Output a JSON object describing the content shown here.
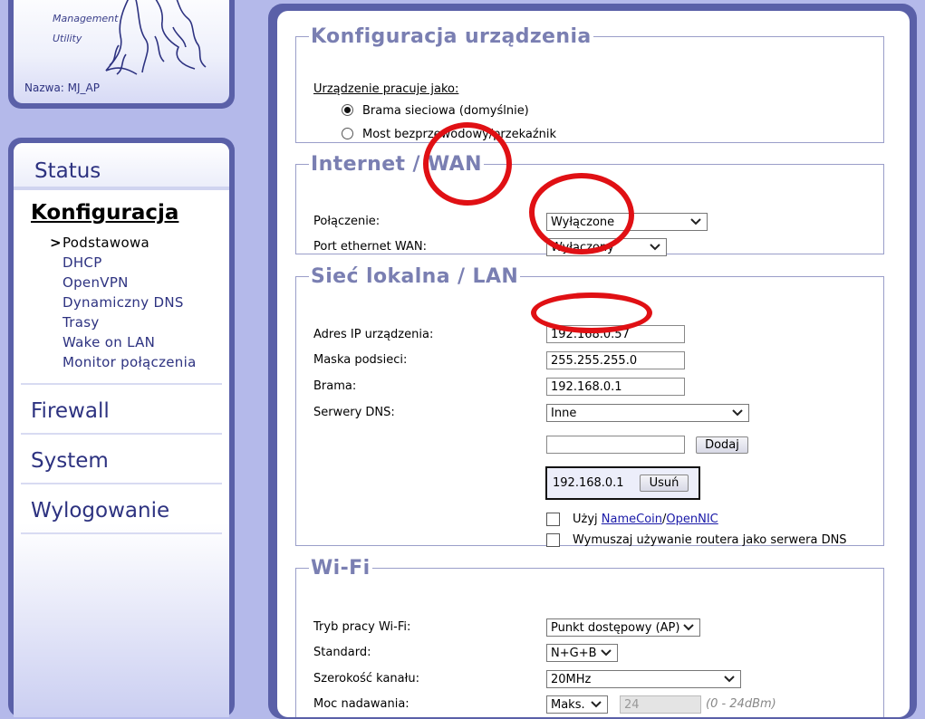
{
  "logo": {
    "line1": "Management",
    "line2": "Utility",
    "name": "Nazwa: MJ_AP"
  },
  "nav": {
    "status": "Status",
    "active": "Konfiguracja",
    "sub_items": [
      "Podstawowa",
      "DHCP",
      "OpenVPN",
      "Dynamiczny DNS",
      "Trasy",
      "Wake on LAN",
      "Monitor połączenia"
    ],
    "current_marker": ">",
    "sections": [
      "Firewall",
      "System",
      "Wylogowanie"
    ]
  },
  "device": {
    "legend": "Konfiguracja urządzenia",
    "mode_label": "Urządzenie pracuje jako:",
    "options": [
      "Brama sieciowa (domyślnie)",
      "Most bezprzewodowy/przekaźnik"
    ],
    "selected_option": 0
  },
  "wan": {
    "legend": "Internet / WAN",
    "connection_label": "Połączenie:",
    "connection_value": "Wyłączone",
    "port_label": "Port ethernet WAN:",
    "port_value": "Wyłączony"
  },
  "lan": {
    "legend": "Sieć lokalna / LAN",
    "ip_label": "Adres IP urządzenia:",
    "ip_value": "192.168.0.57",
    "mask_label": "Maska podsieci:",
    "mask_value": "255.255.255.0",
    "gateway_label": "Brama:",
    "gateway_value": "192.168.0.1",
    "dns_label": "Serwery DNS:",
    "dns_mode": "Inne",
    "dns_new_value": "",
    "add_button": "Dodaj",
    "dns_entries": [
      {
        "ip": "192.168.0.1",
        "remove": "Usuń"
      }
    ],
    "namecoin_prefix": "Użyj ",
    "namecoin_link": "NameCoin",
    "namecoin_sep": "/",
    "opennic_link": "OpenNIC",
    "force_dns_label": "Wymuszaj używanie routera jako serwera DNS",
    "use_namecoin_checked": false,
    "force_dns_checked": false
  },
  "wifi": {
    "legend": "Wi-Fi",
    "mode_label": "Tryb pracy Wi-Fi:",
    "mode_value": "Punkt dostępowy (AP)",
    "standard_label": "Standard:",
    "standard_value": "N+G+B",
    "width_label": "Szerokość kanału:",
    "width_value": "20MHz",
    "power_label": "Moc nadawania:",
    "power_value": "Maks.",
    "power_dbm": "24",
    "power_range": "(0 - 24dBm)"
  },
  "annotation_color": "#e01014"
}
